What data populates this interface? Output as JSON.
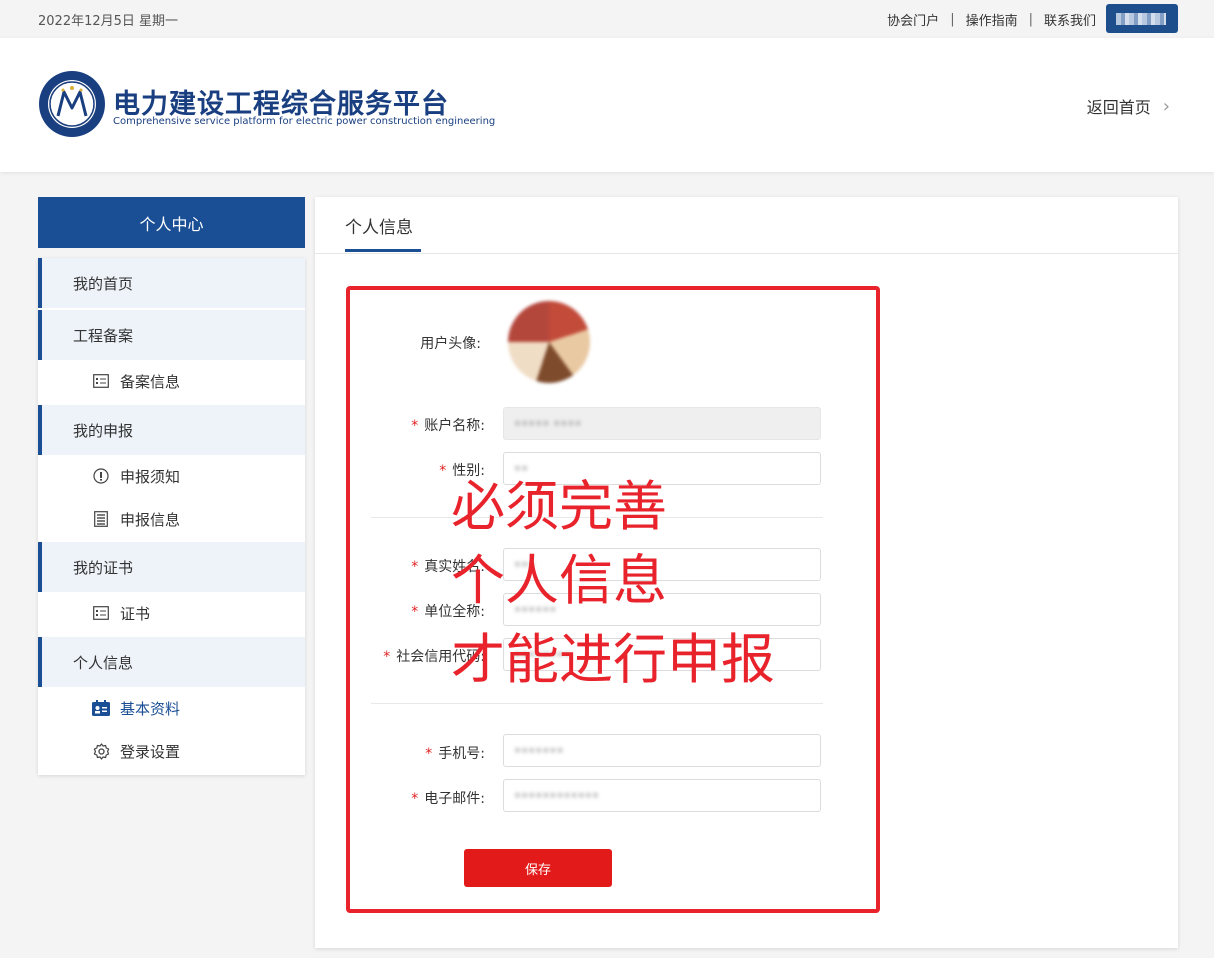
{
  "topbar": {
    "date": "2022年12月5日 星期一",
    "links": [
      "协会门户",
      "操作指南",
      "联系我们"
    ],
    "separator": "|"
  },
  "header": {
    "brand_cn": "电力建设工程综合服务平台",
    "brand_en": "Comprehensive service platform for electric power construction engineering",
    "back_home": "返回首页"
  },
  "sidebar": {
    "title": "个人中心",
    "groups": [
      {
        "label": "我的首页",
        "items": []
      },
      {
        "label": "工程备案",
        "items": [
          {
            "label": "备案信息",
            "icon": "list-card-icon"
          }
        ]
      },
      {
        "label": "我的申报",
        "items": [
          {
            "label": "申报须知",
            "icon": "info-circle-icon"
          },
          {
            "label": "申报信息",
            "icon": "document-list-icon"
          }
        ]
      },
      {
        "label": "我的证书",
        "items": [
          {
            "label": "证书",
            "icon": "list-card-icon"
          }
        ]
      },
      {
        "label": "个人信息",
        "items": [
          {
            "label": "基本资料",
            "icon": "id-card-icon",
            "active": true
          },
          {
            "label": "登录设置",
            "icon": "gear-icon"
          }
        ]
      }
    ]
  },
  "main": {
    "tab": "个人信息",
    "form": {
      "avatar_label": "用户头像:",
      "account_label": "账户名称:",
      "gender_label": "性别:",
      "realname_label": "真实姓名:",
      "company_label": "单位全称:",
      "credit_code_label": "社会信用代码:",
      "phone_label": "手机号:",
      "email_label": "电子邮件:",
      "required_mark": "*",
      "save_label": "保存"
    },
    "annotation": [
      "必须完善",
      "个人信息",
      "才能进行申报"
    ]
  },
  "colors": {
    "brand_blue": "#1b4f95",
    "annotation_red": "#e8232c",
    "save_red": "#e31a1a"
  }
}
